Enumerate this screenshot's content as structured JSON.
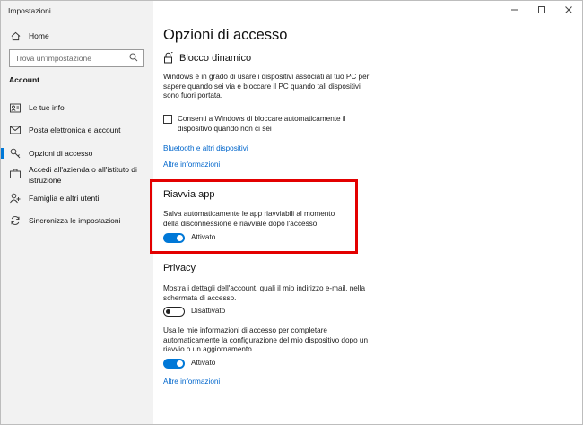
{
  "window": {
    "title": "Impostazioni"
  },
  "sidebar": {
    "home_label": "Home",
    "search_placeholder": "Trova un'impostazione",
    "section_label": "Account",
    "items": [
      {
        "label": "Le tue info",
        "icon": "person-card-icon"
      },
      {
        "label": "Posta elettronica e account",
        "icon": "mail-icon"
      },
      {
        "label": "Opzioni di accesso",
        "icon": "key-icon",
        "selected": true
      },
      {
        "label": "Accedi all'azienda o all'istituto di istruzione",
        "icon": "briefcase-icon"
      },
      {
        "label": "Famiglia e altri utenti",
        "icon": "person-add-icon"
      },
      {
        "label": "Sincronizza le impostazioni",
        "icon": "sync-icon"
      }
    ]
  },
  "main": {
    "title": "Opzioni di accesso",
    "dynamic_lock": {
      "heading": "Blocco dinamico",
      "description": "Windows è in grado di usare i dispositivi associati al tuo PC per sapere quando sei via e bloccare il PC quando tali dispositivi sono fuori portata.",
      "checkbox_label": "Consenti a Windows di bloccare automaticamente il dispositivo quando non ci sei",
      "checkbox_checked": false,
      "link_bluetooth": "Bluetooth e altri dispositivi",
      "link_more": "Altre informazioni"
    },
    "restart_apps": {
      "heading": "Riavvia app",
      "description": "Salva automaticamente le app riavviabili al momento della disconnessione e riavviale dopo l'accesso.",
      "toggle_state": "Attivato",
      "toggle_on": true
    },
    "privacy": {
      "heading": "Privacy",
      "desc1": "Mostra i dettagli dell'account, quali il mio indirizzo e-mail, nella schermata di accesso.",
      "toggle1_state": "Disattivato",
      "toggle1_on": false,
      "desc2": "Usa le mie informazioni di accesso per completare automaticamente la configurazione del mio dispositivo dopo un riavvio o un aggiornamento.",
      "toggle2_state": "Attivato",
      "toggle2_on": true,
      "link_more": "Altre informazioni"
    }
  },
  "colors": {
    "accent": "#0078d7",
    "link": "#0066cc",
    "highlight_border": "#e30000",
    "sidebar_bg": "#f2f2f2"
  }
}
